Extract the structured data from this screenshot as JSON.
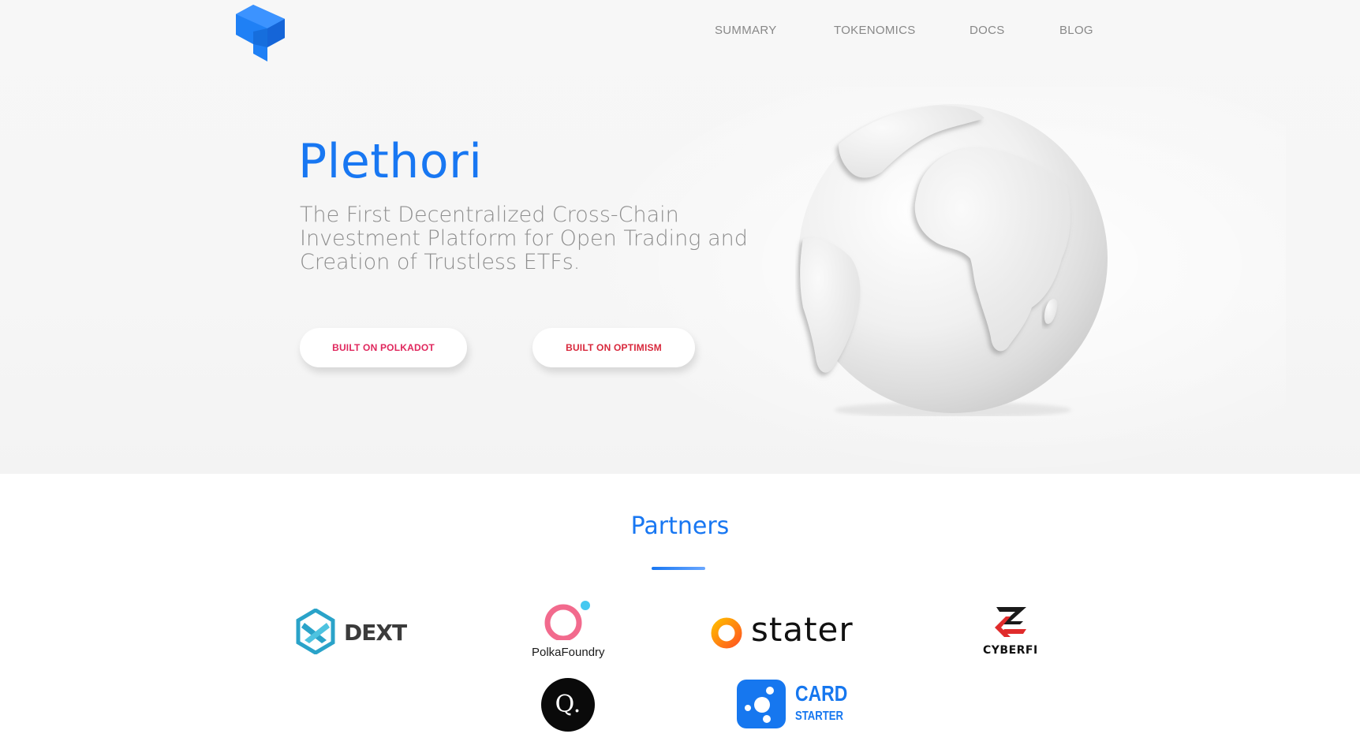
{
  "nav": {
    "items": [
      {
        "label": "SUMMARY"
      },
      {
        "label": "TOKENOMICS"
      },
      {
        "label": "DOCS"
      },
      {
        "label": "BLOG"
      }
    ]
  },
  "hero": {
    "title": "Plethori",
    "subtitle": "The First Decentralized Cross-Chain Investment Platform for Open Trading and Creation of Trustless ETFs.",
    "buttons": [
      {
        "label": "BUILT ON POLKADOT"
      },
      {
        "label": "BUILT ON OPTIMISM"
      }
    ]
  },
  "partners": {
    "title": "Partners",
    "logos": [
      {
        "name": "DEXT",
        "text": "DEXT"
      },
      {
        "name": "PolkaFoundry",
        "text": "PolkaFoundry"
      },
      {
        "name": "stater",
        "text": "stater"
      },
      {
        "name": "CYBERFI",
        "text": "CYBERFI"
      },
      {
        "name": "Q",
        "text": "Q."
      },
      {
        "name": "CardStarter",
        "text_top": "CARD",
        "text_bottom": "STARTER"
      }
    ]
  },
  "colors": {
    "brand_blue": "#1877f2",
    "button_text": "#e0275d",
    "nav_text": "#888888",
    "subtitle_text": "#8e8e8e"
  }
}
